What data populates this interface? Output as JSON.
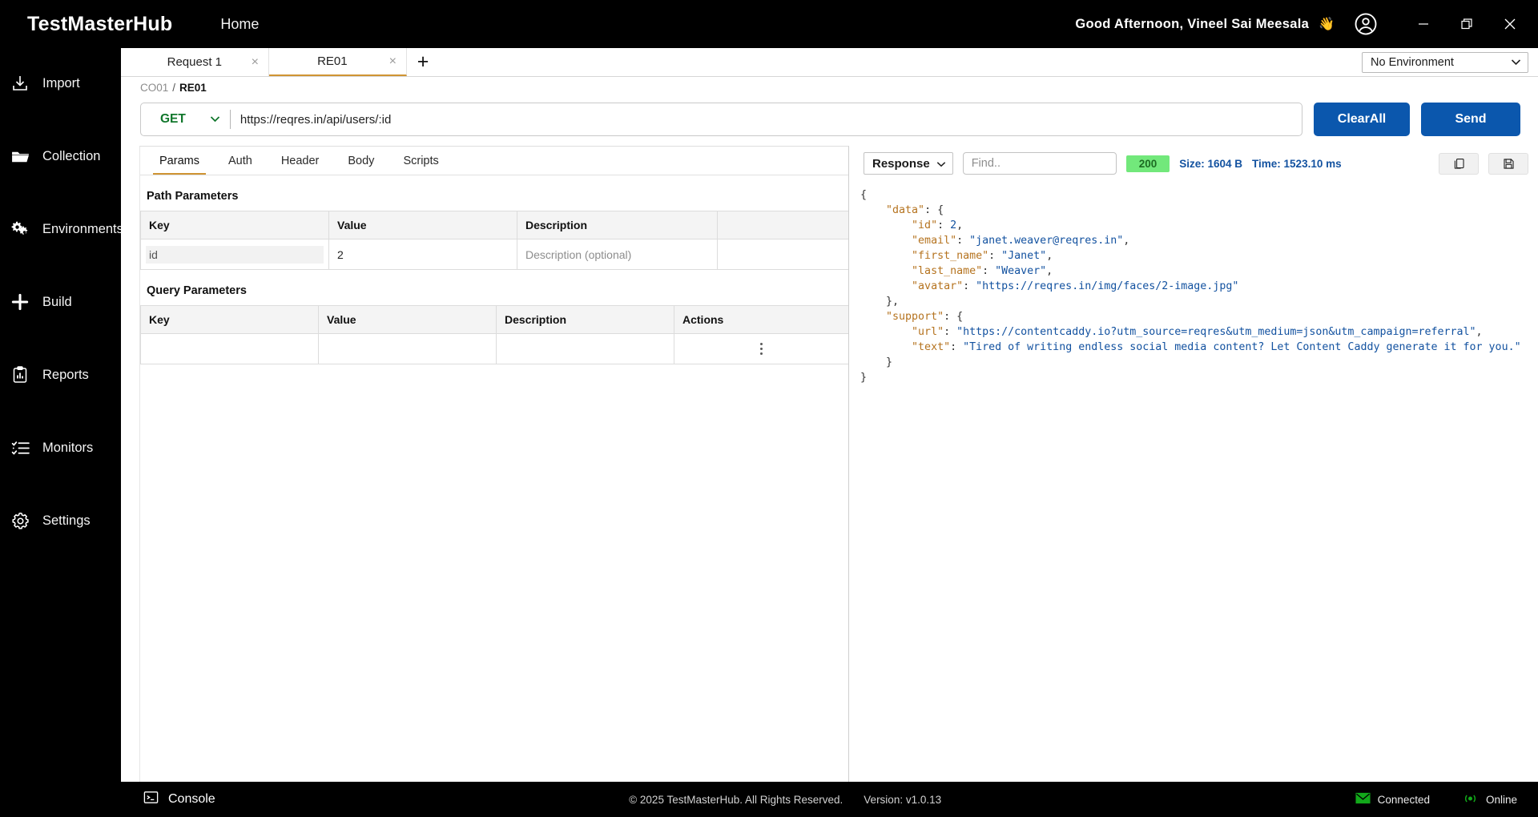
{
  "titlebar": {
    "brand": "TestMasterHub",
    "home": "Home",
    "greeting": "Good Afternoon, Vineel Sai Meesala",
    "wave": "👋",
    "avatar_icon": "user-circle-icon",
    "minimize": "—",
    "maximize": "❐",
    "close": "✕"
  },
  "sidebar": {
    "items": [
      {
        "label": "Import",
        "icon": "import-download-icon"
      },
      {
        "label": "Collection",
        "icon": "folder-icon"
      },
      {
        "label": "Environments",
        "icon": "gears-icon"
      },
      {
        "label": "Build",
        "icon": "plus-icon"
      },
      {
        "label": "Reports",
        "icon": "clipboard-chart-icon"
      },
      {
        "label": "Monitors",
        "icon": "checklist-icon"
      },
      {
        "label": "Settings",
        "icon": "gear-icon"
      }
    ]
  },
  "tabs": {
    "items": [
      {
        "label": "Request 1",
        "active": false,
        "close": "×"
      },
      {
        "label": "RE01",
        "active": true,
        "close": "×"
      }
    ],
    "add_label": "+",
    "environment_value": "No Environment",
    "environment_caret": "⌄"
  },
  "breadcrumb": {
    "collection": "CO01",
    "separator": "/",
    "request": "RE01"
  },
  "url_row": {
    "method": "GET",
    "method_caret": "⌄",
    "url": "https://reqres.in/api/users/:id",
    "clear_all_label": "ClearAll",
    "send_label": "Send"
  },
  "request_tabs": [
    {
      "label": "Params",
      "active": true
    },
    {
      "label": "Auth",
      "active": false
    },
    {
      "label": "Header",
      "active": false
    },
    {
      "label": "Body",
      "active": false
    },
    {
      "label": "Scripts",
      "active": false
    }
  ],
  "path_parameters": {
    "title": "Path Parameters",
    "columns": [
      "Key",
      "Value",
      "Description"
    ],
    "rows": [
      {
        "key": "id",
        "value": "2",
        "description_placeholder": "Description (optional)"
      }
    ]
  },
  "query_parameters": {
    "title": "Query Parameters",
    "columns": [
      "Key",
      "Value",
      "Description",
      "Actions"
    ],
    "rows": [
      {
        "key": "",
        "value": "",
        "description": "",
        "actions_icon": "kebab-menu-icon"
      }
    ]
  },
  "response": {
    "selector_label": "Response",
    "selector_caret": "⌄",
    "find_placeholder": "Find..",
    "status_code": "200",
    "size_label": "Size: 1604 B",
    "time_label": "Time: 1523.10 ms",
    "copy_icon": "copy-icon",
    "save_icon": "save-disk-icon",
    "body_lines": [
      {
        "indent": 0,
        "parts": [
          {
            "t": "{",
            "c": "jp"
          }
        ]
      },
      {
        "indent": 1,
        "parts": [
          {
            "t": "\"data\"",
            "c": "jk"
          },
          {
            "t": ": ",
            "c": "jp"
          },
          {
            "t": "{",
            "c": "jp"
          }
        ]
      },
      {
        "indent": 2,
        "parts": [
          {
            "t": "\"id\"",
            "c": "jk"
          },
          {
            "t": ": ",
            "c": "jp"
          },
          {
            "t": "2",
            "c": "jn"
          },
          {
            "t": ",",
            "c": "jp"
          }
        ]
      },
      {
        "indent": 2,
        "parts": [
          {
            "t": "\"email\"",
            "c": "jk"
          },
          {
            "t": ": ",
            "c": "jp"
          },
          {
            "t": "\"janet.weaver@reqres.in\"",
            "c": "js"
          },
          {
            "t": ",",
            "c": "jp"
          }
        ]
      },
      {
        "indent": 2,
        "parts": [
          {
            "t": "\"first_name\"",
            "c": "jk"
          },
          {
            "t": ": ",
            "c": "jp"
          },
          {
            "t": "\"Janet\"",
            "c": "js"
          },
          {
            "t": ",",
            "c": "jp"
          }
        ]
      },
      {
        "indent": 2,
        "parts": [
          {
            "t": "\"last_name\"",
            "c": "jk"
          },
          {
            "t": ": ",
            "c": "jp"
          },
          {
            "t": "\"Weaver\"",
            "c": "js"
          },
          {
            "t": ",",
            "c": "jp"
          }
        ]
      },
      {
        "indent": 2,
        "parts": [
          {
            "t": "\"avatar\"",
            "c": "jk"
          },
          {
            "t": ": ",
            "c": "jp"
          },
          {
            "t": "\"https://reqres.in/img/faces/2-image.jpg\"",
            "c": "js"
          }
        ]
      },
      {
        "indent": 1,
        "parts": [
          {
            "t": "}",
            "c": "jp"
          },
          {
            "t": ",",
            "c": "jp"
          }
        ]
      },
      {
        "indent": 1,
        "parts": [
          {
            "t": "\"support\"",
            "c": "jk"
          },
          {
            "t": ": ",
            "c": "jp"
          },
          {
            "t": "{",
            "c": "jp"
          }
        ]
      },
      {
        "indent": 2,
        "parts": [
          {
            "t": "\"url\"",
            "c": "jk"
          },
          {
            "t": ": ",
            "c": "jp"
          },
          {
            "t": "\"https://contentcaddy.io?utm_source=reqres&utm_medium=json&utm_campaign=referral\"",
            "c": "js"
          },
          {
            "t": ",",
            "c": "jp"
          }
        ]
      },
      {
        "indent": 2,
        "parts": [
          {
            "t": "\"text\"",
            "c": "jk"
          },
          {
            "t": ": ",
            "c": "jp"
          },
          {
            "t": "\"Tired of writing endless social media content? Let Content Caddy generate it for you.\"",
            "c": "js"
          }
        ]
      },
      {
        "indent": 1,
        "parts": [
          {
            "t": "}",
            "c": "jp"
          }
        ]
      },
      {
        "indent": 0,
        "parts": [
          {
            "t": "}",
            "c": "jp"
          }
        ]
      }
    ]
  },
  "footer": {
    "console_label": "Console",
    "console_icon": "terminal-icon",
    "copyright": "© 2025 TestMasterHub. All Rights Reserved.",
    "version": "Version: v1.0.13",
    "connected_label": "Connected",
    "connected_icon": "envelope-icon",
    "online_label": "Online",
    "online_icon": "signal-icon"
  },
  "colors": {
    "accent_orange": "#cf9433",
    "primary_blue": "#0b57ad",
    "status_green": "#72e87b",
    "method_green": "#11772c",
    "meta_blue": "#1352a0",
    "json_key": "#b5731f",
    "json_string": "#1352a0",
    "online_green": "#12a81a"
  }
}
